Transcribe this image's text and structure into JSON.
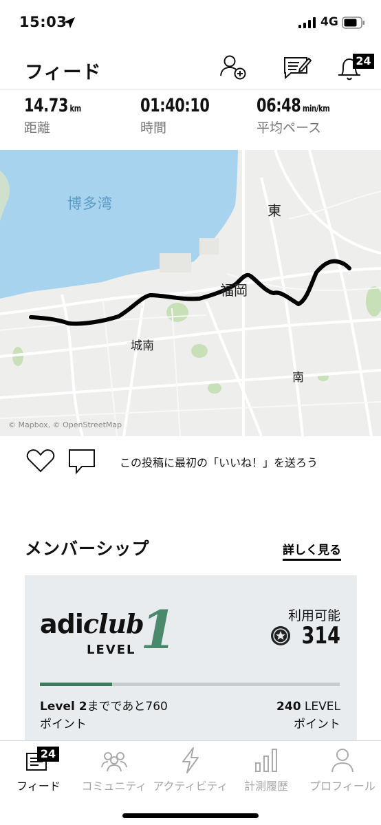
{
  "status_bar": {
    "time": "15:03",
    "network": "4G"
  },
  "header": {
    "title": "フィード",
    "notification_count": "24"
  },
  "stats": [
    {
      "value": "14.73",
      "unit": "km",
      "label": "距離"
    },
    {
      "value": "01:40:10",
      "unit": "",
      "label": "時間"
    },
    {
      "value": "06:48",
      "unit": "min/km",
      "label": "平均ペース"
    }
  ],
  "map": {
    "labels": {
      "bay": "博多湾",
      "east": "東",
      "fukuoka": "福岡",
      "jonan": "城南",
      "minami": "南"
    },
    "attribution": "© Mapbox, © OpenStreetMap"
  },
  "actions": {
    "like_prompt": "この投稿に最初の「いいね！」を送ろう"
  },
  "membership": {
    "title": "メンバーシップ",
    "see_more": "詳しく見る",
    "logo_prefix": "adi",
    "logo_suffix": "club",
    "level_word": "LEVEL",
    "level_number": "1",
    "available_label": "利用可能",
    "points": "314",
    "progress": 0.24,
    "next_level_bold": "Level 2",
    "next_level_text": "までであと760",
    "next_level_line2": "ポイント",
    "level_points_bold": "240",
    "level_points_text": " LEVEL",
    "level_points_line2": "ポイント"
  },
  "bottom_nav": {
    "items": [
      {
        "label": "フィード",
        "icon": "feed-icon",
        "active": true,
        "badge": "24"
      },
      {
        "label": "コミュニティ",
        "icon": "community-icon",
        "active": false
      },
      {
        "label": "アクティビティ",
        "icon": "lightning-icon",
        "active": false
      },
      {
        "label": "計測履歴",
        "icon": "bar-chart-icon",
        "active": false
      },
      {
        "label": "プロフィール",
        "icon": "person-icon",
        "active": false
      }
    ]
  },
  "colors": {
    "accent_green": "#4a8a6c",
    "progress_green": "#3f7a5e",
    "water": "#a8d3ef",
    "card_bg": "#e9ecef"
  }
}
